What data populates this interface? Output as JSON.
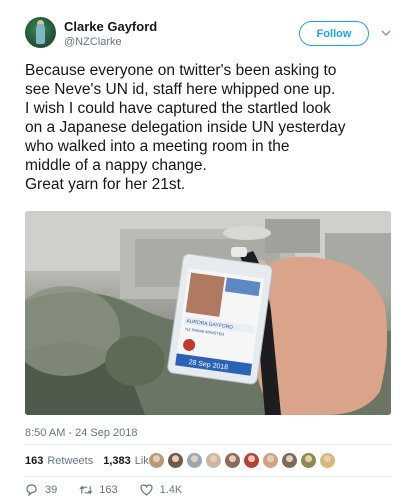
{
  "author": {
    "name": "Clarke Gayford",
    "handle": "@NZClarke"
  },
  "follow_button": {
    "label": "Follow"
  },
  "tweet": {
    "lines": [
      "Because everyone on twitter's been asking to",
      "see Neve's UN id, staff here whipped one up.",
      "I wish I could have captured the startled look",
      "on a Japanese delegation inside UN yesterday",
      "who walked into a meeting room in the",
      "middle of a nappy change.",
      "Great yarn for her 21st."
    ]
  },
  "photo": {
    "badge_name": "AURORA GAYFORD",
    "badge_role": "NZ PRIME MINISTER",
    "badge_date": "28 Sep 2018"
  },
  "timestamp": "8:50 AM - 24 Sep 2018",
  "stats": {
    "retweets_count": "163",
    "retweets_label": "Retweets",
    "likes_count": "1,383",
    "likes_label": "Likes"
  },
  "liker_colors": [
    "#b59b7a",
    "#6e5a4b",
    "#9aa6b5",
    "#c9b7a4",
    "#8a6a5c",
    "#b5403a",
    "#caa487",
    "#7d6b5a",
    "#8c8a52",
    "#d7b77a"
  ],
  "actions": {
    "reply_count": "39",
    "retweet_count": "163",
    "like_count": "1.4K"
  },
  "colors": {
    "accent": "#1da1f2",
    "text": "#14171a",
    "muted": "#657786"
  }
}
